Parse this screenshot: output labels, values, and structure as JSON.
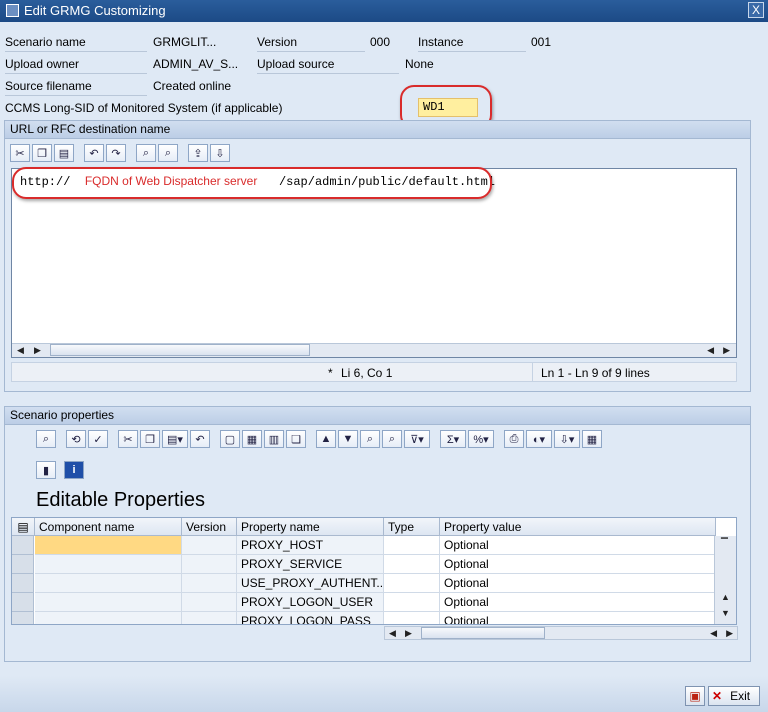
{
  "window": {
    "title": "Edit GRMG Customizing",
    "close_glyph": "X"
  },
  "header": {
    "scenario_name_label": "Scenario name",
    "scenario_name_value": "GRMGLIT...",
    "version_label": "Version",
    "version_value": "000",
    "instance_label": "Instance",
    "instance_value": "001",
    "upload_owner_label": "Upload owner",
    "upload_owner_value": "ADMIN_AV_S...",
    "upload_source_label": "Upload source",
    "upload_source_value": "None",
    "source_filename_label": "Source filename",
    "source_filename_value": "Created online",
    "ccms_label": "CCMS Long-SID of Monitored System (if applicable)",
    "ccms_value": "WD1"
  },
  "url_group": {
    "title": "URL or RFC destination name",
    "editor": {
      "prefix": "http://",
      "annotation": "FQDN of Web Dispatcher server",
      "suffix": "/sap/admin/public/default.html"
    },
    "status": {
      "modified_marker": "*",
      "cursor": "Li 6, Co 1",
      "lines": "Ln 1 - Ln 9 of 9 lines"
    }
  },
  "props_group": {
    "title": "Scenario properties",
    "heading": "Editable Properties",
    "columns": [
      "Component name",
      "Version",
      "Property name",
      "Type",
      "Property value"
    ],
    "rows": [
      {
        "component": "",
        "version": "",
        "property": "PROXY_HOST",
        "type": "",
        "value": "Optional"
      },
      {
        "component": "",
        "version": "",
        "property": "PROXY_SERVICE",
        "type": "",
        "value": "Optional"
      },
      {
        "component": "",
        "version": "",
        "property": "USE_PROXY_AUTHENT...",
        "type": "",
        "value": "Optional"
      },
      {
        "component": "",
        "version": "",
        "property": "PROXY_LOGON_USER",
        "type": "",
        "value": "Optional"
      },
      {
        "component": "",
        "version": "",
        "property": "PROXY_LOGON_PASS",
        "type": "",
        "value": "Optional"
      }
    ]
  },
  "footer": {
    "exit_label": "Exit"
  },
  "colors": {
    "annotation_red": "#d92b2b",
    "field_yellow": "#ffef9f",
    "title_blue": "#1c4a86"
  }
}
